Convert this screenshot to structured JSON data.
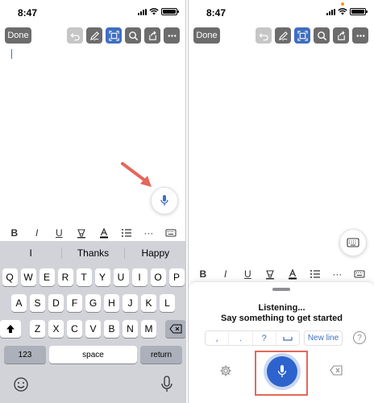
{
  "left": {
    "status": {
      "time": "8:47"
    },
    "toolbar": {
      "done_label": "Done"
    },
    "format_bar": {
      "bold": "B",
      "italic": "I",
      "underline": "U",
      "more": "···"
    },
    "keyboard": {
      "suggestions": [
        "I",
        "Thanks",
        "Happy"
      ],
      "row1": [
        "Q",
        "W",
        "E",
        "R",
        "T",
        "Y",
        "U",
        "I",
        "O",
        "P"
      ],
      "row2": [
        "A",
        "S",
        "D",
        "F",
        "G",
        "H",
        "J",
        "K",
        "L"
      ],
      "row3": [
        "Z",
        "X",
        "C",
        "V",
        "B",
        "N",
        "M"
      ],
      "numbers_label": "123",
      "space_label": "space",
      "return_label": "return"
    }
  },
  "right": {
    "status": {
      "time": "8:47"
    },
    "toolbar": {
      "done_label": "Done"
    },
    "format_bar": {
      "bold": "B",
      "italic": "I",
      "underline": "U",
      "more": "···"
    },
    "dictation": {
      "title": "Listening...",
      "subtitle": "Say something to get started",
      "punctuation": [
        ",",
        ".",
        "?"
      ],
      "new_line_label": "New line",
      "help_label": "?"
    }
  },
  "colors": {
    "accent": "#3f6fc1",
    "mic_button": "#2d63cc",
    "highlight_box": "#e4685c",
    "arrow": "#e4685c"
  }
}
